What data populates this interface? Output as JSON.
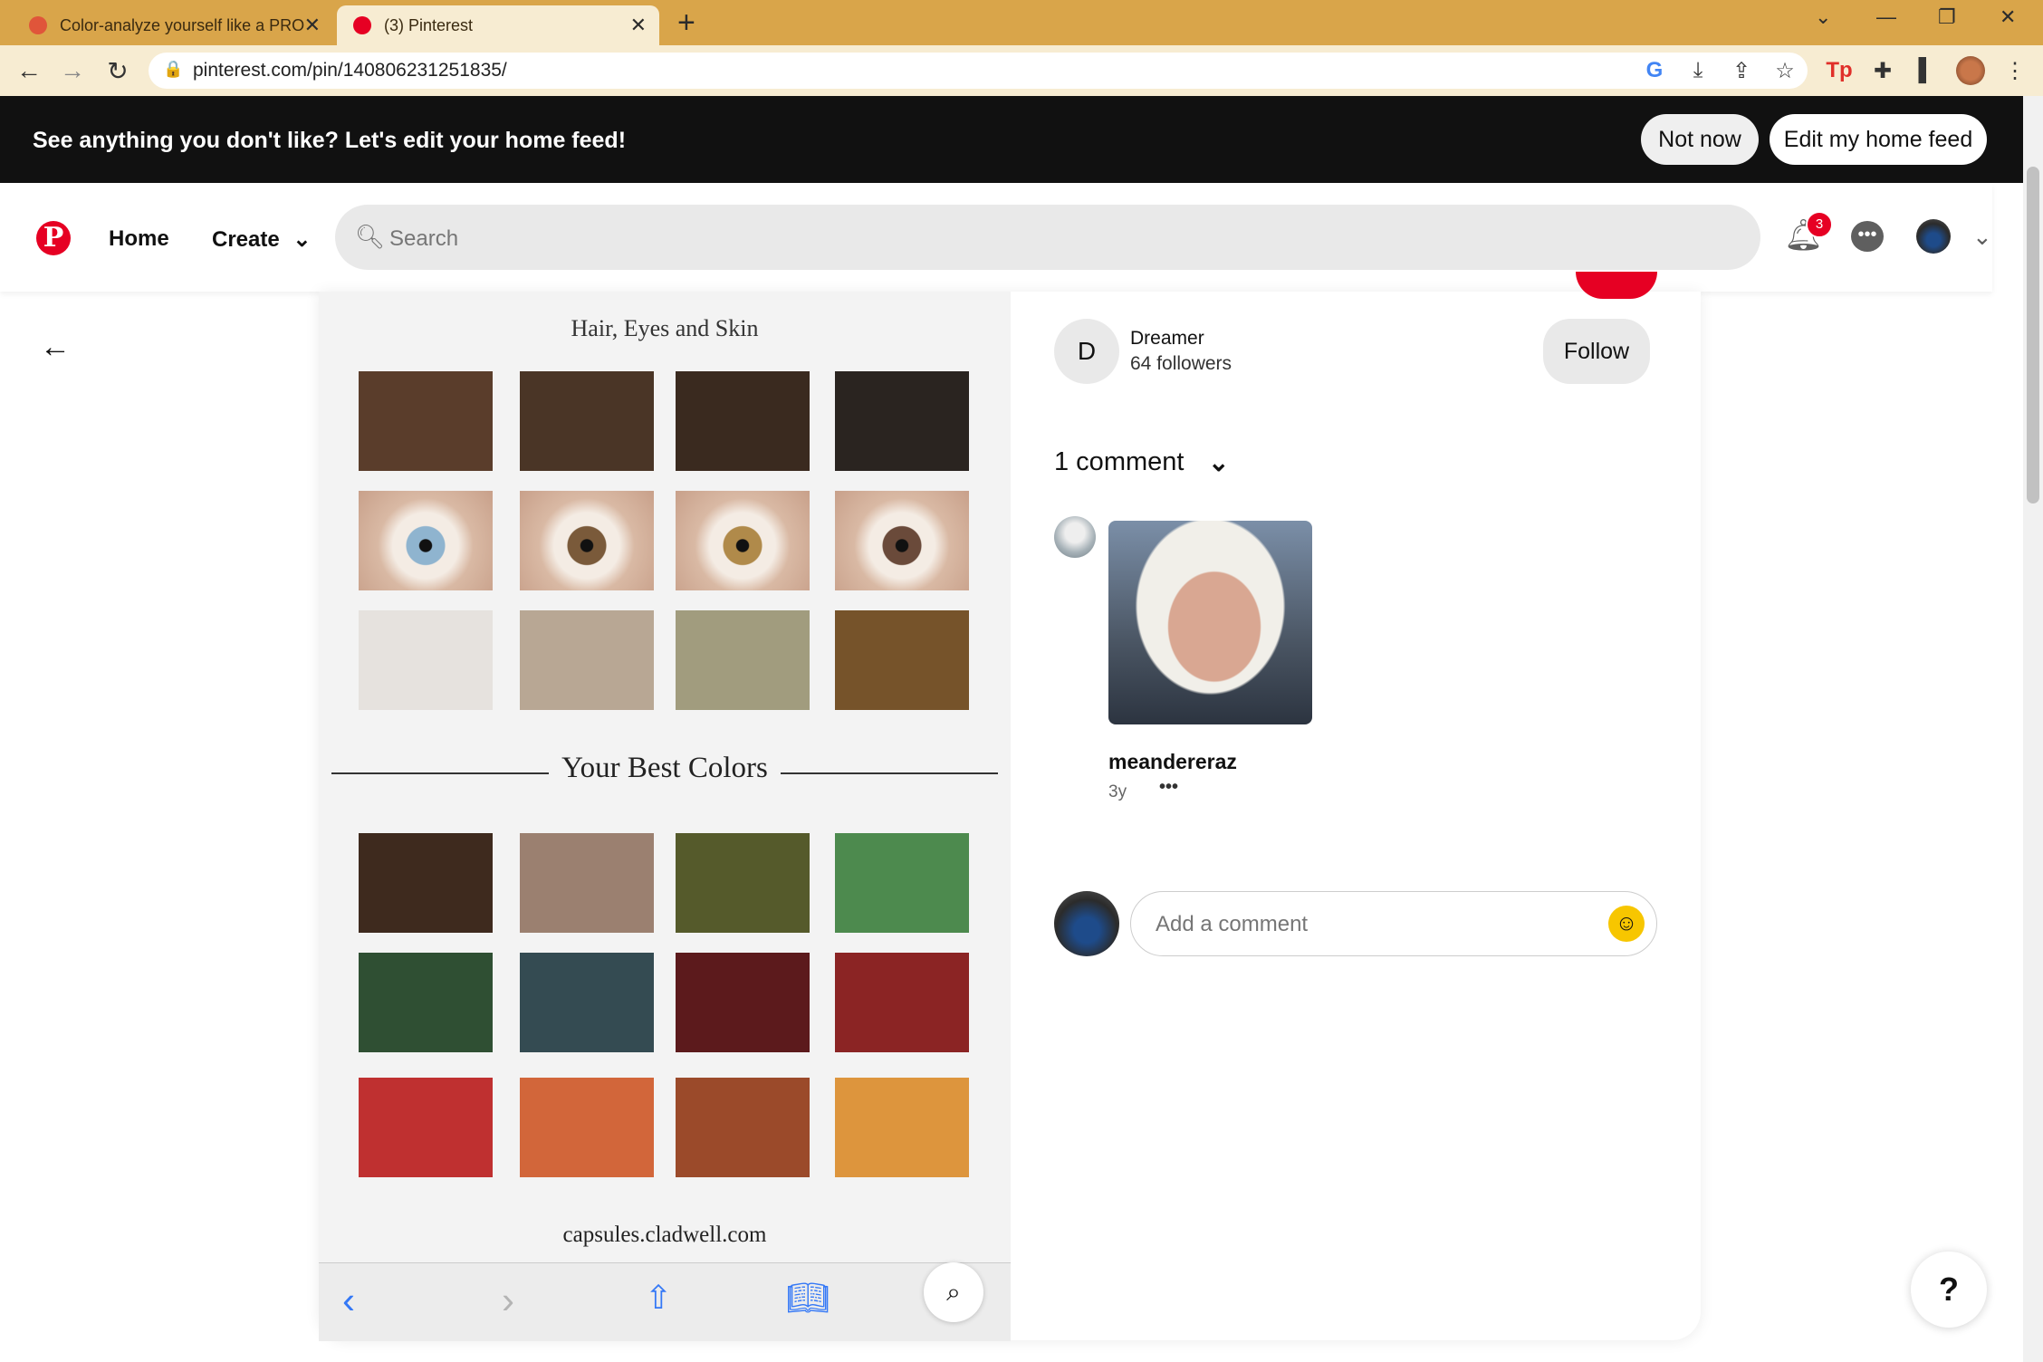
{
  "browser": {
    "tabs": [
      {
        "title": "Color-analyze yourself like a PRO",
        "active": false,
        "favicon_color": "#e0553a"
      },
      {
        "title": "(3) Pinterest",
        "active": true,
        "favicon_color": "#e60023"
      }
    ],
    "new_tab": "+",
    "url": "pinterest.com/pin/140806231251835/"
  },
  "banner": {
    "text": "See anything you don't like? Let's edit your home feed!",
    "not_now": "Not now",
    "edit_feed": "Edit my home feed"
  },
  "header": {
    "logo": "P",
    "home": "Home",
    "create": "Create",
    "search_placeholder": "Search",
    "notifications_count": "3"
  },
  "pin": {
    "caption": "Hair, Eyes and Skin",
    "hair_colors": [
      "#5a3d2b",
      "#4a3526",
      "#3a2a1f",
      "#2a2420"
    ],
    "eye_colors": [
      "#8fb4cf",
      "#7a5a3a",
      "#b08a4a",
      "#6a4a3a"
    ],
    "skin_colors": [
      "#e6e2de",
      "#b8a794",
      "#a19c7e",
      "#76532a"
    ],
    "best_title": "Your Best Colors",
    "best_colors": [
      "#3e2a1e",
      "#9b8070",
      "#555a2b",
      "#4d8a4e",
      "#2f4f33",
      "#344b52",
      "#5c1a1c",
      "#8b2424",
      "#bf3030",
      "#d2663a",
      "#9b4a2a",
      "#dd953d"
    ],
    "source": "capsules.cladwell.com"
  },
  "author": {
    "initial": "D",
    "name": "Dreamer",
    "followers": "64 followers",
    "follow": "Follow"
  },
  "comments": {
    "heading": "1 comment",
    "items": [
      {
        "user": "meandereraz",
        "time": "3y",
        "more": "•••"
      }
    ],
    "add_placeholder": "Add a comment"
  },
  "help": "?"
}
